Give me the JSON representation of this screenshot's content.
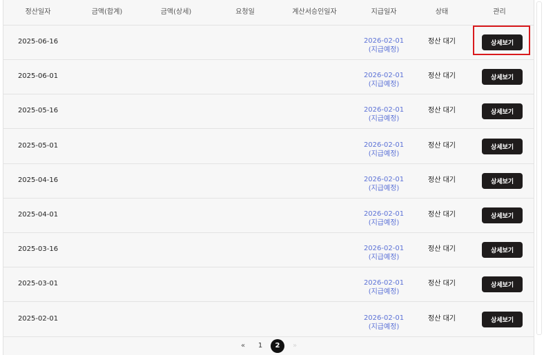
{
  "table": {
    "headers": [
      "정산일자",
      "금액(합계)",
      "금액(상세)",
      "요청일",
      "계산서승인일자",
      "지급일자",
      "상태",
      "관리"
    ],
    "rows": [
      {
        "settle_date": "2025-06-16",
        "pay_date": "2026-02-01",
        "pay_note": "(지급예정)",
        "status": "정산 대기",
        "action": "상세보기"
      },
      {
        "settle_date": "2025-06-01",
        "pay_date": "2026-02-01",
        "pay_note": "(지급예정)",
        "status": "정산 대기",
        "action": "상세보기"
      },
      {
        "settle_date": "2025-05-16",
        "pay_date": "2026-02-01",
        "pay_note": "(지급예정)",
        "status": "정산 대기",
        "action": "상세보기"
      },
      {
        "settle_date": "2025-05-01",
        "pay_date": "2026-02-01",
        "pay_note": "(지급예정)",
        "status": "정산 대기",
        "action": "상세보기"
      },
      {
        "settle_date": "2025-04-16",
        "pay_date": "2026-02-01",
        "pay_note": "(지급예정)",
        "status": "정산 대기",
        "action": "상세보기"
      },
      {
        "settle_date": "2025-04-01",
        "pay_date": "2026-02-01",
        "pay_note": "(지급예정)",
        "status": "정산 대기",
        "action": "상세보기"
      },
      {
        "settle_date": "2025-03-16",
        "pay_date": "2026-02-01",
        "pay_note": "(지급예정)",
        "status": "정산 대기",
        "action": "상세보기"
      },
      {
        "settle_date": "2025-03-01",
        "pay_date": "2026-02-01",
        "pay_note": "(지급예정)",
        "status": "정산 대기",
        "action": "상세보기"
      },
      {
        "settle_date": "2025-02-01",
        "pay_date": "2026-02-01",
        "pay_note": "(지급예정)",
        "status": "정산 대기",
        "action": "상세보기"
      }
    ]
  },
  "pagination": {
    "prev": "«",
    "pages": [
      "1",
      "2"
    ],
    "current": "2",
    "next": "»"
  },
  "colors": {
    "pay_date_link": "#5b71d6",
    "button_bg": "#1f1c1c",
    "highlight_border": "#d9191c",
    "current_page_bg": "#111111"
  }
}
